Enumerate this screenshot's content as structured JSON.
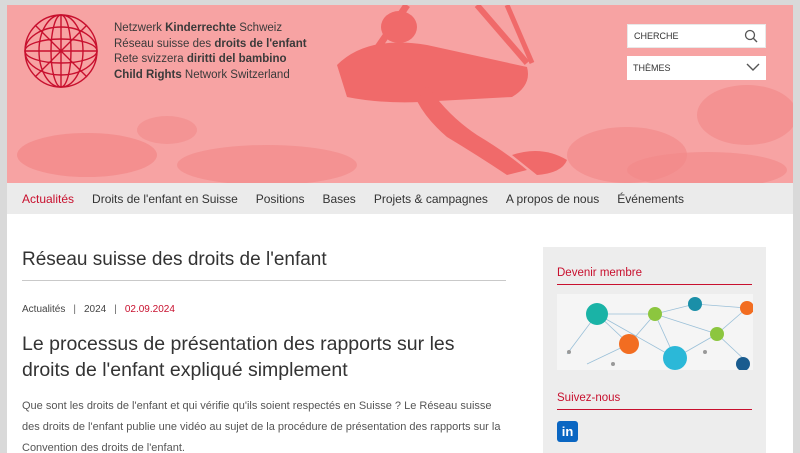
{
  "brand": {
    "lines": [
      {
        "pre": "Netzwerk ",
        "bold": "Kinderrechte",
        "post": " Schweiz"
      },
      {
        "pre": "Réseau suisse des ",
        "bold": "droits de l'enfant",
        "post": ""
      },
      {
        "pre": "Rete svizzera ",
        "bold": "diritti del bambino",
        "post": ""
      },
      {
        "pre": "",
        "bold": "Child Rights",
        "post": " Network Switzerland"
      }
    ]
  },
  "header": {
    "search_placeholder": "CHERCHE",
    "themes_label": "THÈMES"
  },
  "nav": {
    "items": [
      "Actualités",
      "Droits de l'enfant en Suisse",
      "Positions",
      "Bases",
      "Projets & campagnes",
      "A propos de nous",
      "Événements"
    ],
    "active_index": 0
  },
  "main": {
    "page_title": "Réseau suisse des droits de l'enfant",
    "meta": {
      "category": "Actualités",
      "year": "2024",
      "date": "02.09.2024"
    },
    "article_title": "Le processus de présentation des rapports sur les droits de l'enfant expliqué simplement",
    "lead": "Que sont les droits de l'enfant et qui vérifie qu'ils soient respectés en Suisse ? Le Réseau suisse des droits de l'enfant publie une vidéo au sujet de la procédure de présentation des rapports sur la Convention des droits de l'enfant."
  },
  "sidebar": {
    "member_heading": "Devenir membre",
    "follow_heading": "Suivez-nous",
    "linkedin_glyph": "in"
  },
  "colors": {
    "accent": "#c8102e",
    "hero_pink": "#f7a3a3",
    "shadow_red": "#f06a6a",
    "linkedin": "#0a66c2"
  }
}
